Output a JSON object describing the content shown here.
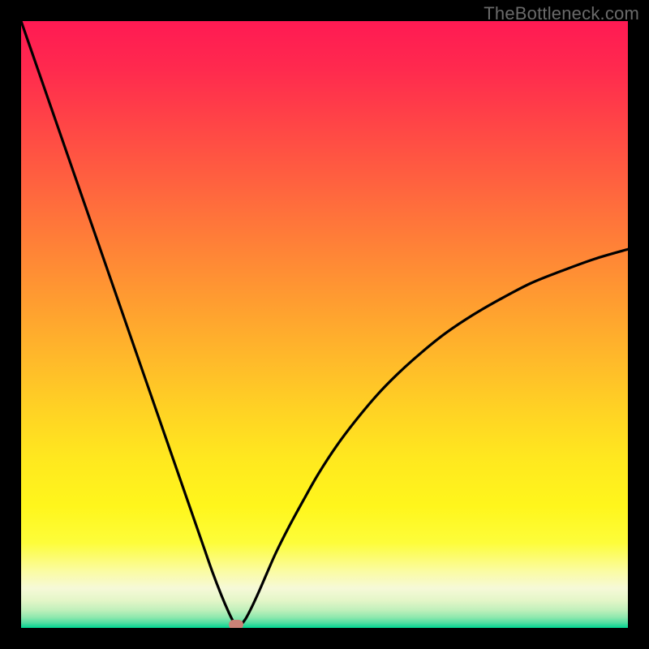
{
  "watermark": "TheBottleneck.com",
  "colors": {
    "frame": "#000000",
    "curve": "#000000",
    "marker": "#cb8277"
  },
  "gradient_stops": [
    {
      "pct": 0.0,
      "color": "#ff1a53"
    },
    {
      "pct": 0.08,
      "color": "#ff2a4e"
    },
    {
      "pct": 0.16,
      "color": "#ff4247"
    },
    {
      "pct": 0.24,
      "color": "#ff5a41"
    },
    {
      "pct": 0.32,
      "color": "#ff723b"
    },
    {
      "pct": 0.4,
      "color": "#ff8a35"
    },
    {
      "pct": 0.48,
      "color": "#ffa22f"
    },
    {
      "pct": 0.56,
      "color": "#ffba2a"
    },
    {
      "pct": 0.64,
      "color": "#ffd224"
    },
    {
      "pct": 0.72,
      "color": "#ffe81f"
    },
    {
      "pct": 0.8,
      "color": "#fff61c"
    },
    {
      "pct": 0.86,
      "color": "#fdfd3a"
    },
    {
      "pct": 0.905,
      "color": "#fbfca0"
    },
    {
      "pct": 0.935,
      "color": "#f6f9d8"
    },
    {
      "pct": 0.955,
      "color": "#e4f6c8"
    },
    {
      "pct": 0.97,
      "color": "#c0f0bb"
    },
    {
      "pct": 0.982,
      "color": "#8ee8ae"
    },
    {
      "pct": 0.992,
      "color": "#4fddA0"
    },
    {
      "pct": 1.0,
      "color": "#00d490"
    }
  ],
  "chart_data": {
    "type": "line",
    "title": "",
    "xlabel": "",
    "ylabel": "",
    "xlim": [
      0,
      100
    ],
    "ylim": [
      0,
      100
    ],
    "grid": false,
    "legend": false,
    "series": [
      {
        "name": "bottleneck-curve",
        "x": [
          0.0,
          2.5,
          5.0,
          7.5,
          10.0,
          12.5,
          15.0,
          17.5,
          20.0,
          22.5,
          25.0,
          27.5,
          30.0,
          31.5,
          33.0,
          34.2,
          35.0,
          35.6,
          36.2,
          37.0,
          38.0,
          39.2,
          40.5,
          42.0,
          44.0,
          46.5,
          49.0,
          52.0,
          55.0,
          58.5,
          62.0,
          66.0,
          70.0,
          74.5,
          79.0,
          84.0,
          89.0,
          94.5,
          100.0
        ],
        "y": [
          100.0,
          92.8,
          85.6,
          78.4,
          71.2,
          64.0,
          56.8,
          49.6,
          42.4,
          35.2,
          28.0,
          20.8,
          13.6,
          9.3,
          5.4,
          2.6,
          1.0,
          0.2,
          0.5,
          1.5,
          3.4,
          6.0,
          9.0,
          12.4,
          16.4,
          21.0,
          25.4,
          30.0,
          34.0,
          38.2,
          41.8,
          45.4,
          48.6,
          51.6,
          54.2,
          56.8,
          58.8,
          60.8,
          62.4
        ]
      }
    ],
    "marker": {
      "x": 35.4,
      "y": 0.0
    }
  }
}
